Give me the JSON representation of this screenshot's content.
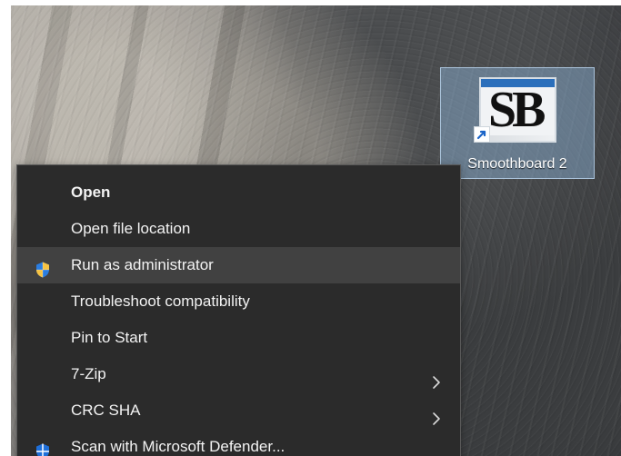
{
  "desktop": {
    "shortcut": {
      "label": "Smoothboard 2",
      "icon_text": "SB",
      "icon_name": "smoothboard-app-icon",
      "badge_icon": "shortcut-arrow-icon"
    }
  },
  "context_menu": {
    "items": [
      {
        "label": "Open",
        "bold": true,
        "icon": "",
        "submenu": false,
        "highlighted": false
      },
      {
        "label": "Open file location",
        "bold": false,
        "icon": "",
        "submenu": false,
        "highlighted": false
      },
      {
        "label": "Run as administrator",
        "bold": false,
        "icon": "uac-shield-icon",
        "submenu": false,
        "highlighted": true
      },
      {
        "label": "Troubleshoot compatibility",
        "bold": false,
        "icon": "",
        "submenu": false,
        "highlighted": false
      },
      {
        "label": "Pin to Start",
        "bold": false,
        "icon": "",
        "submenu": false,
        "highlighted": false
      },
      {
        "label": "7-Zip",
        "bold": false,
        "icon": "",
        "submenu": true,
        "highlighted": false
      },
      {
        "label": "CRC SHA",
        "bold": false,
        "icon": "",
        "submenu": true,
        "highlighted": false
      },
      {
        "label": "Scan with Microsoft Defender...",
        "bold": false,
        "icon": "microsoft-defender-icon",
        "submenu": false,
        "highlighted": false
      }
    ]
  },
  "colors": {
    "menu_background": "#2b2b2b",
    "menu_highlight": "#414141",
    "menu_text": "#f3f3f3",
    "selection_blue": "#8fb5dc",
    "defender_blue": "#1e6fd9",
    "uac_blue": "#2a7de1",
    "uac_yellow": "#f6c343"
  }
}
